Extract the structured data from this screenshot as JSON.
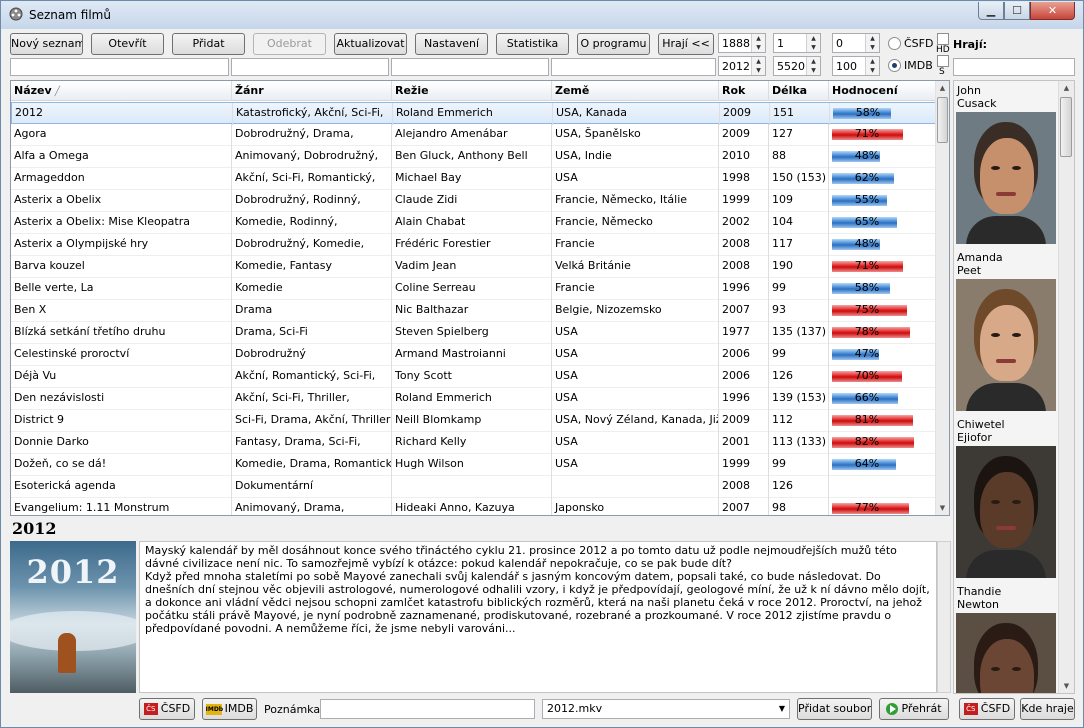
{
  "window": {
    "title": "Seznam filmů"
  },
  "toolbar": {
    "new_list": "Nový seznam",
    "open": "Otevřít",
    "add": "Přidat",
    "remove": "Odebrat",
    "update": "Aktualizovat",
    "settings": "Nastavení",
    "stats": "Statistika",
    "about": "O programu",
    "actors_toggle": "Hrají <<"
  },
  "filters": {
    "year_from": "1888",
    "year_to": "2012",
    "length_from": "1",
    "length_to": "5520",
    "rating_from": "0",
    "rating_to": "100",
    "source_csfd": "ČSFD",
    "source_imdb": "IMDB",
    "hd_label": "HD",
    "s_label": "S",
    "actors_label": "Hrají:"
  },
  "table": {
    "columns": [
      "Název",
      "Žánr",
      "Režie",
      "Země",
      "Rok",
      "Délka",
      "Hodnocení"
    ],
    "rows": [
      {
        "name": "2012",
        "genre": "Katastrofický, Akční, Sci-Fi,",
        "director": "Roland Emmerich",
        "country": "USA, Kanada",
        "year": "2009",
        "length": "151",
        "rating": 58,
        "rating_text": "58%",
        "color": "blue"
      },
      {
        "name": "Agora",
        "genre": "Dobrodružný, Drama,",
        "director": "Alejandro Amenábar",
        "country": "USA, Španělsko",
        "year": "2009",
        "length": "127",
        "rating": 71,
        "rating_text": "71%",
        "color": "red"
      },
      {
        "name": "Alfa a Omega",
        "genre": "Animovaný, Dobrodružný,",
        "director": "Ben Gluck, Anthony Bell",
        "country": "USA, Indie",
        "year": "2010",
        "length": "88",
        "rating": 48,
        "rating_text": "48%",
        "color": "blue"
      },
      {
        "name": "Armageddon",
        "genre": "Akční, Sci-Fi, Romantický,",
        "director": "Michael Bay",
        "country": "USA",
        "year": "1998",
        "length": "150 (153)",
        "rating": 62,
        "rating_text": "62%",
        "color": "blue"
      },
      {
        "name": "Asterix a Obelix",
        "genre": "Dobrodružný, Rodinný,",
        "director": "Claude Zidi",
        "country": "Francie, Německo, Itálie",
        "year": "1999",
        "length": "109",
        "rating": 55,
        "rating_text": "55%",
        "color": "blue"
      },
      {
        "name": "Asterix a Obelix: Mise Kleopatra",
        "genre": "Komedie, Rodinný,",
        "director": "Alain Chabat",
        "country": "Francie, Německo",
        "year": "2002",
        "length": "104",
        "rating": 65,
        "rating_text": "65%",
        "color": "blue"
      },
      {
        "name": "Asterix a Olympijské hry",
        "genre": "Dobrodružný, Komedie,",
        "director": "Frédéric Forestier",
        "country": "Francie",
        "year": "2008",
        "length": "117",
        "rating": 48,
        "rating_text": "48%",
        "color": "blue"
      },
      {
        "name": "Barva kouzel",
        "genre": "Komedie, Fantasy",
        "director": "Vadim Jean",
        "country": "Velká Británie",
        "year": "2008",
        "length": "190",
        "rating": 71,
        "rating_text": "71%",
        "color": "red"
      },
      {
        "name": "Belle verte, La",
        "genre": "Komedie",
        "director": "Coline Serreau",
        "country": "Francie",
        "year": "1996",
        "length": "99",
        "rating": 58,
        "rating_text": "58%",
        "color": "blue"
      },
      {
        "name": "Ben X",
        "genre": "Drama",
        "director": "Nic Balthazar",
        "country": "Belgie, Nizozemsko",
        "year": "2007",
        "length": "93",
        "rating": 75,
        "rating_text": "75%",
        "color": "red"
      },
      {
        "name": "Blízká setkání třetího druhu",
        "genre": "Drama, Sci-Fi",
        "director": "Steven Spielberg",
        "country": "USA",
        "year": "1977",
        "length": "135 (137)",
        "rating": 78,
        "rating_text": "78%",
        "color": "red"
      },
      {
        "name": "Celestinské proroctví",
        "genre": "Dobrodružný",
        "director": "Armand Mastroianni",
        "country": "USA",
        "year": "2006",
        "length": "99",
        "rating": 47,
        "rating_text": "47%",
        "color": "blue"
      },
      {
        "name": "Déjà Vu",
        "genre": "Akční, Romantický, Sci-Fi,",
        "director": "Tony Scott",
        "country": "USA",
        "year": "2006",
        "length": "126",
        "rating": 70,
        "rating_text": "70%",
        "color": "red"
      },
      {
        "name": "Den nezávislosti",
        "genre": "Akční, Sci-Fi, Thriller,",
        "director": "Roland Emmerich",
        "country": "USA",
        "year": "1996",
        "length": "139 (153)",
        "rating": 66,
        "rating_text": "66%",
        "color": "blue"
      },
      {
        "name": "District 9",
        "genre": "Sci-Fi, Drama, Akční, Thriller",
        "director": "Neill Blomkamp",
        "country": "USA, Nový Zéland, Kanada, Jižní",
        "year": "2009",
        "length": "112",
        "rating": 81,
        "rating_text": "81%",
        "color": "red"
      },
      {
        "name": "Donnie Darko",
        "genre": "Fantasy, Drama, Sci-Fi,",
        "director": "Richard Kelly",
        "country": "USA",
        "year": "2001",
        "length": "113 (133)",
        "rating": 82,
        "rating_text": "82%",
        "color": "red"
      },
      {
        "name": "Dožeň, co se dá!",
        "genre": "Komedie, Drama, Romantický",
        "director": "Hugh Wilson",
        "country": "USA",
        "year": "1999",
        "length": "99",
        "rating": 64,
        "rating_text": "64%",
        "color": "blue"
      },
      {
        "name": "Esoterická agenda",
        "genre": "Dokumentární",
        "director": "",
        "country": "",
        "year": "2008",
        "length": "126",
        "rating": null,
        "rating_text": "",
        "color": "none"
      },
      {
        "name": "Evangelium: 1.11 Monstrum",
        "genre": "Animovaný, Drama,",
        "director": "Hideaki Anno, Kazuya",
        "country": "Japonsko",
        "year": "2007",
        "length": "98",
        "rating": 77,
        "rating_text": "77%",
        "color": "red"
      }
    ]
  },
  "detail": {
    "title": "2012",
    "poster_title": "2012",
    "description": "Mayský kalendář by měl dosáhnout konce svého třináctého cyklu 21. prosince 2012 a po tomto datu už podle nejmoudřejších mužů této dávné civilizace není nic. To samozřejmě vybízí k otázce: pokud kalendář nepokračuje, co se pak bude dít?\nKdyž před mnoha staletími po sobě Mayové zanechali svůj kalendář s jasným koncovým datem, popsali také, co bude následovat. Do dnešních dní stejnou věc objevili astrologové, numerologové odhalili vzory, i když je předpovídají, geologové míní, že už k ní dávno mělo dojít, a dokonce ani vládní vědci nejsou schopni zamlčet katastrofu biblických rozměrů, která na naši planetu čeká v roce 2012. Proroctví, na jehož počátku stáli právě Mayové, je nyní podrobně zaznamenané, prodiskutované, rozebrané a prozkoumané. V roce 2012 zjistíme pravdu o předpovídané povodni. A nemůžeme říci, že jsme nebyli varováni..."
  },
  "actors": [
    {
      "name": "John\nCusack"
    },
    {
      "name": "Amanda\nPeet"
    },
    {
      "name": "Chiwetel\nEjiofor"
    },
    {
      "name": "Thandie\nNewton"
    }
  ],
  "bottom": {
    "csfd": "ČSFD",
    "imdb": "IMDB",
    "note_label": "Poznámka:",
    "note_value": "",
    "file": "2012.mkv",
    "add_file": "Přidat soubor",
    "play": "Přehrát",
    "csfd2": "ČSFD",
    "where_plays": "Kde hraje"
  }
}
